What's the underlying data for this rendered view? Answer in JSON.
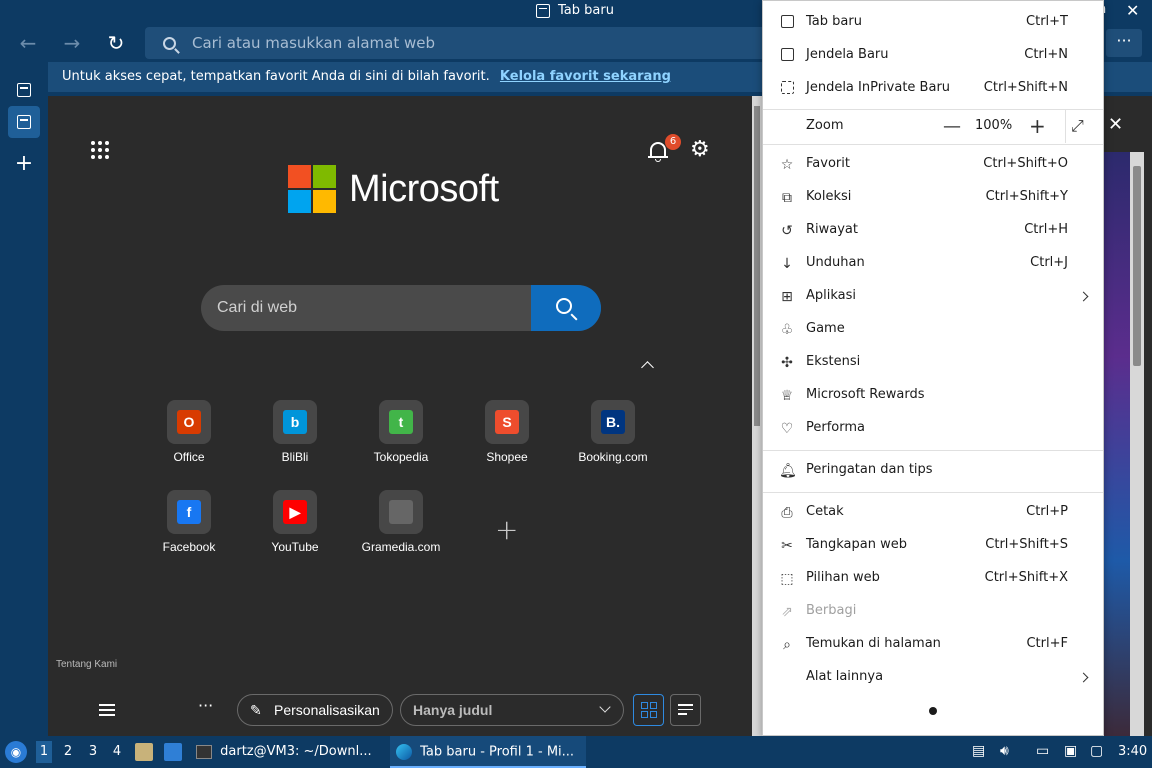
{
  "window": {
    "title": "Tab baru"
  },
  "nav": {
    "address_placeholder": "Cari atau masukkan alamat web",
    "more_label": "···"
  },
  "favbar": {
    "text": "Untuk akses cepat, tempatkan favorit Anda di sini di bilah favorit.",
    "link": "Kelola favorit sekarang"
  },
  "newtab": {
    "brand": "Microsoft",
    "search_placeholder": "Cari di web",
    "notification_count": "6",
    "about_label": "Tentang Kami",
    "quicklinks": [
      {
        "label": "Office",
        "color": "#d83b01",
        "glyph": "O"
      },
      {
        "label": "BliBli",
        "color": "#0095da",
        "glyph": "b"
      },
      {
        "label": "Tokopedia",
        "color": "#42b549",
        "glyph": "t"
      },
      {
        "label": "Shopee",
        "color": "#ee4d2d",
        "glyph": "S"
      },
      {
        "label": "Booking.com",
        "color": "#003580",
        "glyph": "B."
      },
      {
        "label": "Facebook",
        "color": "#1877f2",
        "glyph": "f"
      },
      {
        "label": "YouTube",
        "color": "#ff0000",
        "glyph": "▶"
      },
      {
        "label": "Gramedia.com",
        "color": "#666666",
        "glyph": ""
      }
    ],
    "personalize_label": "Personalisasikan",
    "layout_label": "Hanya judul"
  },
  "menu": {
    "items": [
      {
        "label": "Tab baru",
        "shortcut": "Ctrl+T",
        "icon": "new-tab-icon"
      },
      {
        "label": "Jendela Baru",
        "shortcut": "Ctrl+N",
        "icon": "new-window-icon"
      },
      {
        "label": "Jendela InPrivate Baru",
        "shortcut": "Ctrl+Shift+N",
        "icon": "inprivate-icon"
      },
      {
        "label": "Zoom",
        "value": "100%",
        "icon": "zoom-icon"
      },
      {
        "label": "Favorit",
        "shortcut": "Ctrl+Shift+O",
        "icon": "star-icon"
      },
      {
        "label": "Koleksi",
        "shortcut": "Ctrl+Shift+Y",
        "icon": "collections-icon"
      },
      {
        "label": "Riwayat",
        "shortcut": "Ctrl+H",
        "icon": "history-icon"
      },
      {
        "label": "Unduhan",
        "shortcut": "Ctrl+J",
        "icon": "download-icon"
      },
      {
        "label": "Aplikasi",
        "shortcut": "",
        "icon": "apps-icon"
      },
      {
        "label": "Game",
        "shortcut": "",
        "icon": "game-icon"
      },
      {
        "label": "Ekstensi",
        "shortcut": "",
        "icon": "extensions-icon"
      },
      {
        "label": "Microsoft Rewards",
        "shortcut": "",
        "icon": "rewards-icon"
      },
      {
        "label": "Performa",
        "shortcut": "",
        "icon": "performance-icon"
      },
      {
        "label": "Peringatan dan tips",
        "shortcut": "",
        "icon": "bell-icon"
      },
      {
        "label": "Cetak",
        "shortcut": "Ctrl+P",
        "icon": "print-icon"
      },
      {
        "label": "Tangkapan web",
        "shortcut": "Ctrl+Shift+S",
        "icon": "screenshot-icon"
      },
      {
        "label": "Pilihan web",
        "shortcut": "Ctrl+Shift+X",
        "icon": "web-select-icon"
      },
      {
        "label": "Berbagi",
        "shortcut": "",
        "icon": "share-icon"
      },
      {
        "label": "Temukan di halaman",
        "shortcut": "Ctrl+F",
        "icon": "find-icon"
      },
      {
        "label": "Alat lainnya",
        "shortcut": "",
        "icon": "more-tools-icon"
      }
    ]
  },
  "taskbar": {
    "workspaces": [
      "1",
      "2",
      "3",
      "4"
    ],
    "terminal_task": "dartz@VM3: ~/Downl...",
    "browser_task": "Tab baru - Profil 1 - Mi...",
    "clock": "3:40"
  }
}
